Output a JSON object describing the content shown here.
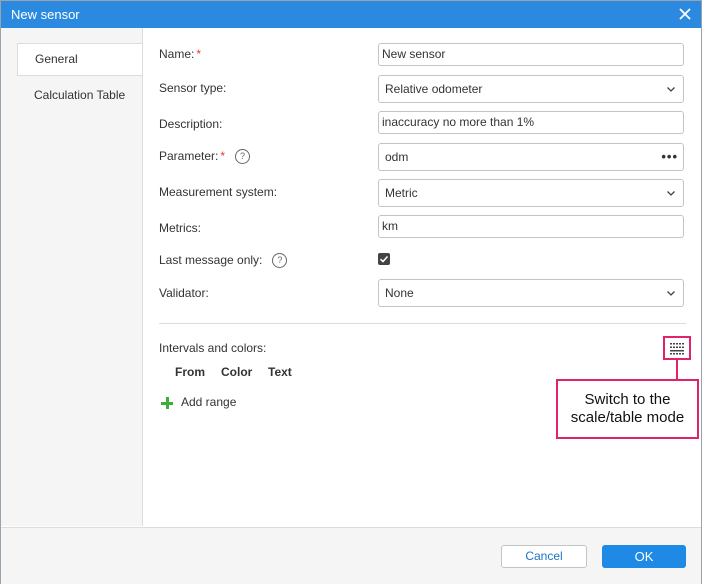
{
  "dialog": {
    "title": "New sensor"
  },
  "tabs": [
    {
      "label": "General"
    },
    {
      "label": "Calculation Table"
    }
  ],
  "form": {
    "name": {
      "label": "Name:",
      "required_mark": "*",
      "value": "New sensor"
    },
    "sensor_type": {
      "label": "Sensor type:",
      "value": "Relative odometer"
    },
    "description": {
      "label": "Description:",
      "value": "inaccuracy no more than 1%"
    },
    "parameter": {
      "label": "Parameter:",
      "required_mark": "*",
      "help": "?",
      "value": "odm",
      "more": "•••"
    },
    "measurement_system": {
      "label": "Measurement system:",
      "value": "Metric"
    },
    "metrics": {
      "label": "Metrics:",
      "value": "km"
    },
    "last_message_only": {
      "label": "Last message only:",
      "help": "?",
      "checked": true
    },
    "validator": {
      "label": "Validator:",
      "value": "None"
    }
  },
  "intervals": {
    "label": "Intervals and colors:",
    "columns": [
      "From",
      "Color",
      "Text"
    ],
    "add_range": "Add range"
  },
  "callout": {
    "line1": "Switch to the",
    "line2": "scale/table mode"
  },
  "footer": {
    "cancel": "Cancel",
    "ok": "OK"
  },
  "colors": {
    "titlebar": "#2b8ae0",
    "ok_button": "#1e8ae6",
    "callout": "#e0246c",
    "add_icon": "#3eae3a"
  }
}
